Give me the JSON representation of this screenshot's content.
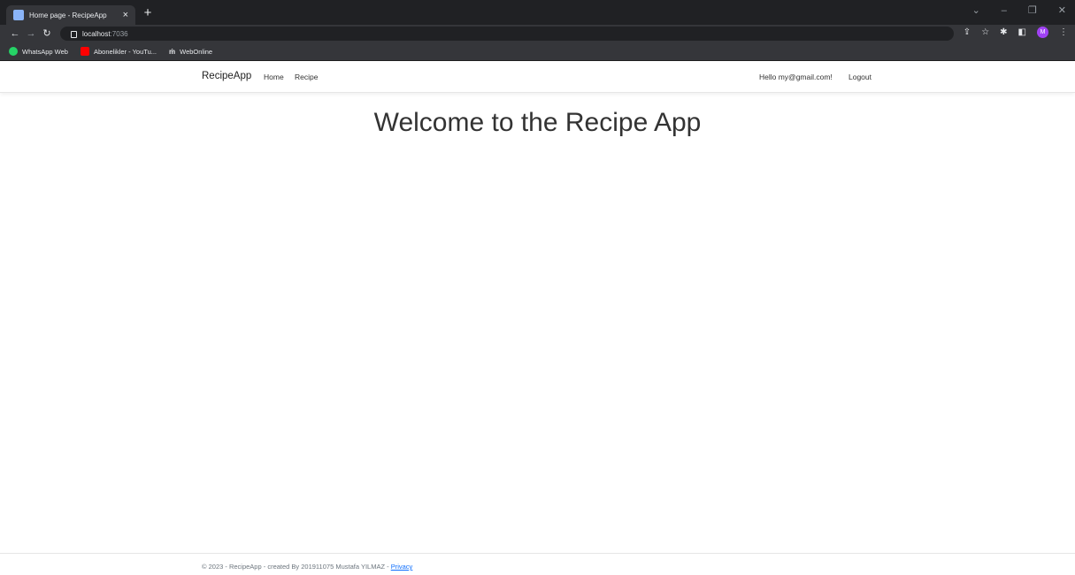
{
  "browser": {
    "tab_title": "Home page - RecipeApp",
    "url_host": "localhost",
    "url_port": ":7036",
    "avatar_letter": "M",
    "bookmarks": [
      {
        "label": "WhatsApp Web",
        "icon": "whatsapp-icon"
      },
      {
        "label": "Abonelikler - YouTu...",
        "icon": "youtube-icon"
      },
      {
        "label": "WebOnline",
        "icon": "webonline-icon"
      }
    ]
  },
  "navbar": {
    "brand": "RecipeApp",
    "links": [
      "Home",
      "Recipe"
    ],
    "greeting": "Hello my@gmail.com!",
    "logout": "Logout"
  },
  "main": {
    "heading": "Welcome to the Recipe App"
  },
  "footer": {
    "text": "© 2023 - RecipeApp - created By 201911075 Mustafa YILMAZ - ",
    "privacy": "Privacy"
  },
  "colors": {
    "chrome_dark": "#202124",
    "chrome_toolbar": "#35363a",
    "link_blue": "#0d6efd"
  }
}
